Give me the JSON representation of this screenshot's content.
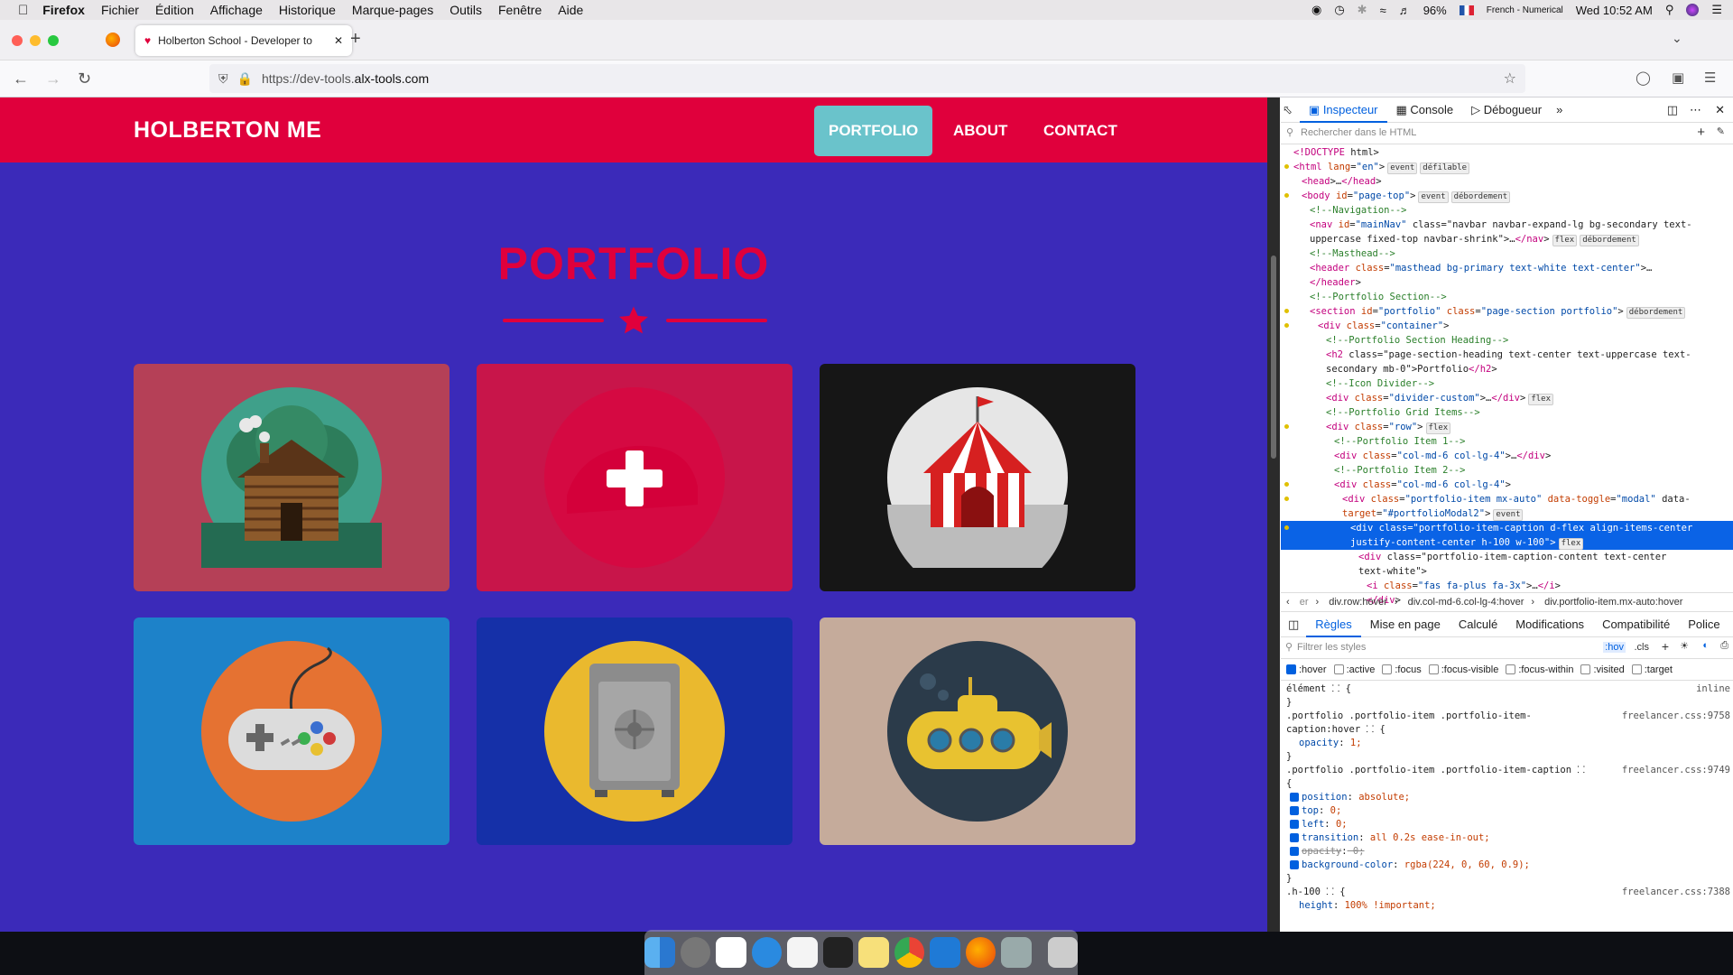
{
  "menubar": {
    "app": "Firefox",
    "items": [
      "Fichier",
      "Édition",
      "Affichage",
      "Historique",
      "Marque-pages",
      "Outils",
      "Fenêtre",
      "Aide"
    ],
    "battery": "96%",
    "keyboard": "French - Numerical",
    "clock": "Wed 10:52 AM"
  },
  "browser": {
    "tab_title": "Holberton School - Developer to",
    "url_prefix": "https://dev-tools.",
    "url_domain": "alx-tools.com"
  },
  "site": {
    "brand": "HOLBERTON ME",
    "nav": [
      "PORTFOLIO",
      "ABOUT",
      "CONTACT"
    ],
    "section_title": "PORTFOLIO",
    "colors": {
      "primary": "#e0003c",
      "background": "#3b2ab9",
      "active_nav": "#6ac3cb"
    },
    "cards": [
      {
        "name": "cabin",
        "bg": "#b54057"
      },
      {
        "name": "cake",
        "bg": "#c8154a"
      },
      {
        "name": "circus",
        "bg": "#161616"
      },
      {
        "name": "game",
        "bg": "#1d82c9"
      },
      {
        "name": "safe",
        "bg": "#1530a8"
      },
      {
        "name": "submarine",
        "bg": "#c5ab9b"
      }
    ]
  },
  "devtools": {
    "tabs": [
      "Inspecteur",
      "Console",
      "Débogueur"
    ],
    "search_placeholder": "Rechercher dans le HTML",
    "breadcrumb": [
      "er",
      "div.row:hover",
      "div.col-md-6.col-lg-4:hover",
      "div.portfolio-item.mx-auto:hover"
    ],
    "rule_tabs": [
      "Règles",
      "Mise en page",
      "Calculé",
      "Modifications",
      "Compatibilité",
      "Police"
    ],
    "filter_placeholder": "Filtrer les styles",
    "filter_buttons": [
      ":hov",
      ".cls"
    ],
    "pseudo": [
      ":hover",
      ":active",
      ":focus",
      ":focus-visible",
      ":focus-within",
      ":visited",
      ":target"
    ],
    "tree": [
      {
        "d": 0,
        "t": "<!DOCTYPE html>"
      },
      {
        "d": 0,
        "t": "<html lang=\"en\">",
        "b": [
          "event",
          "défilable"
        ],
        "dot": true
      },
      {
        "d": 1,
        "t": "<head>…</head>"
      },
      {
        "d": 1,
        "t": "<body id=\"page-top\">",
        "b": [
          "event",
          "débordement"
        ],
        "dot": true
      },
      {
        "d": 2,
        "t": "<!--Navigation-->",
        "c": true
      },
      {
        "d": 2,
        "t": "<nav id=\"mainNav\" class=\"navbar navbar-expand-lg bg-secondary text-"
      },
      {
        "d": 2,
        "t": "uppercase fixed-top navbar-shrink\">…</nav>",
        "b": [
          "flex",
          "débordement"
        ]
      },
      {
        "d": 2,
        "t": "<!--Masthead-->",
        "c": true
      },
      {
        "d": 2,
        "t": "<header class=\"masthead bg-primary text-white text-center\">…"
      },
      {
        "d": 2,
        "t": "</header>"
      },
      {
        "d": 2,
        "t": "<!--Portfolio Section-->",
        "c": true
      },
      {
        "d": 2,
        "t": "<section id=\"portfolio\" class=\"page-section portfolio\">",
        "b": [
          "débordement"
        ],
        "dot": true
      },
      {
        "d": 3,
        "t": "<div class=\"container\">",
        "dot": true
      },
      {
        "d": 4,
        "t": "<!--Portfolio Section Heading-->",
        "c": true
      },
      {
        "d": 4,
        "t": "<h2 class=\"page-section-heading text-center text-uppercase text-"
      },
      {
        "d": 4,
        "t": "secondary mb-0\">Portfolio</h2>"
      },
      {
        "d": 4,
        "t": "<!--Icon Divider-->",
        "c": true
      },
      {
        "d": 4,
        "t": "<div class=\"divider-custom\">…</div>",
        "b": [
          "flex"
        ]
      },
      {
        "d": 4,
        "t": "<!--Portfolio Grid Items-->",
        "c": true
      },
      {
        "d": 4,
        "t": "<div class=\"row\">",
        "b": [
          "flex"
        ],
        "dot": true
      },
      {
        "d": 5,
        "t": "<!--Portfolio Item 1-->",
        "c": true
      },
      {
        "d": 5,
        "t": "<div class=\"col-md-6 col-lg-4\">…</div>"
      },
      {
        "d": 5,
        "t": "<!--Portfolio Item 2-->",
        "c": true
      },
      {
        "d": 5,
        "t": "<div class=\"col-md-6 col-lg-4\">",
        "dot": true
      },
      {
        "d": 6,
        "t": "<div class=\"portfolio-item mx-auto\" data-toggle=\"modal\" data-",
        "dot": true
      },
      {
        "d": 6,
        "t": "target=\"#portfolioModal2\">",
        "b": [
          "event"
        ]
      },
      {
        "d": 7,
        "t": "<div class=\"portfolio-item-caption d-flex align-items-center",
        "sel": true,
        "dot": true
      },
      {
        "d": 7,
        "t": "justify-content-center h-100 w-100\">",
        "b": [
          "flex"
        ],
        "sel": true
      },
      {
        "d": 8,
        "t": "<div class=\"portfolio-item-caption-content text-center"
      },
      {
        "d": 8,
        "t": "text-white\">"
      },
      {
        "d": 9,
        "t": "<i class=\"fas fa-plus fa-3x\">…</i>"
      },
      {
        "d": 9,
        "t": "</div>"
      }
    ],
    "rules": [
      {
        "t": "élément ⸬ {",
        "src": "inline"
      },
      {
        "t": "}"
      },
      {
        "t": ".portfolio .portfolio-item .portfolio-item-",
        "src": "freelancer.css:9758"
      },
      {
        "t": "caption:hover ⸬ {"
      },
      {
        "p": "opacity",
        "v": "1;"
      },
      {
        "t": "}"
      },
      {
        "t": ".portfolio .portfolio-item .portfolio-item-caption ⸬",
        "src": "freelancer.css:9749"
      },
      {
        "t": "{"
      },
      {
        "p": "position",
        "v": "absolute;",
        "c": true
      },
      {
        "p": "top",
        "v": "0;",
        "c": true
      },
      {
        "p": "left",
        "v": "0;",
        "c": true
      },
      {
        "p": "transition",
        "v": "all 0.2s ease-in-out;",
        "c": true
      },
      {
        "p": "opacity",
        "v": "0;",
        "c": true,
        "strike": true
      },
      {
        "p": "background-color",
        "v": "rgba(224, 0, 60, 0.9);",
        "c": true
      },
      {
        "t": "}"
      },
      {
        "t": ".h-100 ⸬ {",
        "src": "freelancer.css:7388"
      },
      {
        "p": "height",
        "v": "100% !important;"
      }
    ]
  }
}
